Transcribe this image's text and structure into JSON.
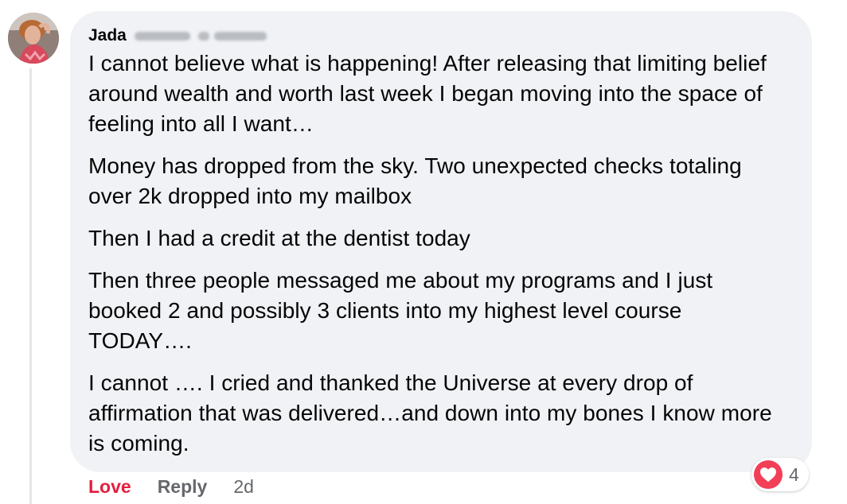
{
  "comment": {
    "author_first_name": "Jada",
    "paragraphs": [
      "I cannot believe what is happening! After releasing that limiting belief around wealth and worth last week I began moving into the space of feeling into all I want…",
      "Money has dropped from the sky. Two unexpected checks totaling over 2k dropped into my mailbox",
      "Then I had a credit at the dentist today",
      "Then three people messaged me about my programs and I just booked 2 and possibly 3 clients into my highest level course TODAY….",
      "I cannot …. I cried and thanked the Universe at every drop of affirmation that was delivered…and down into my bones I know more is coming."
    ]
  },
  "actions": {
    "love_label": "Love",
    "reply_label": "Reply",
    "timestamp": "2d"
  },
  "reactions": {
    "icon": "heart-icon",
    "count": "4"
  },
  "colors": {
    "bubble_bg": "#f0f2f5",
    "love_red": "#e41e3f",
    "muted_gray": "#65676b",
    "reaction_red": "#f33e58"
  }
}
